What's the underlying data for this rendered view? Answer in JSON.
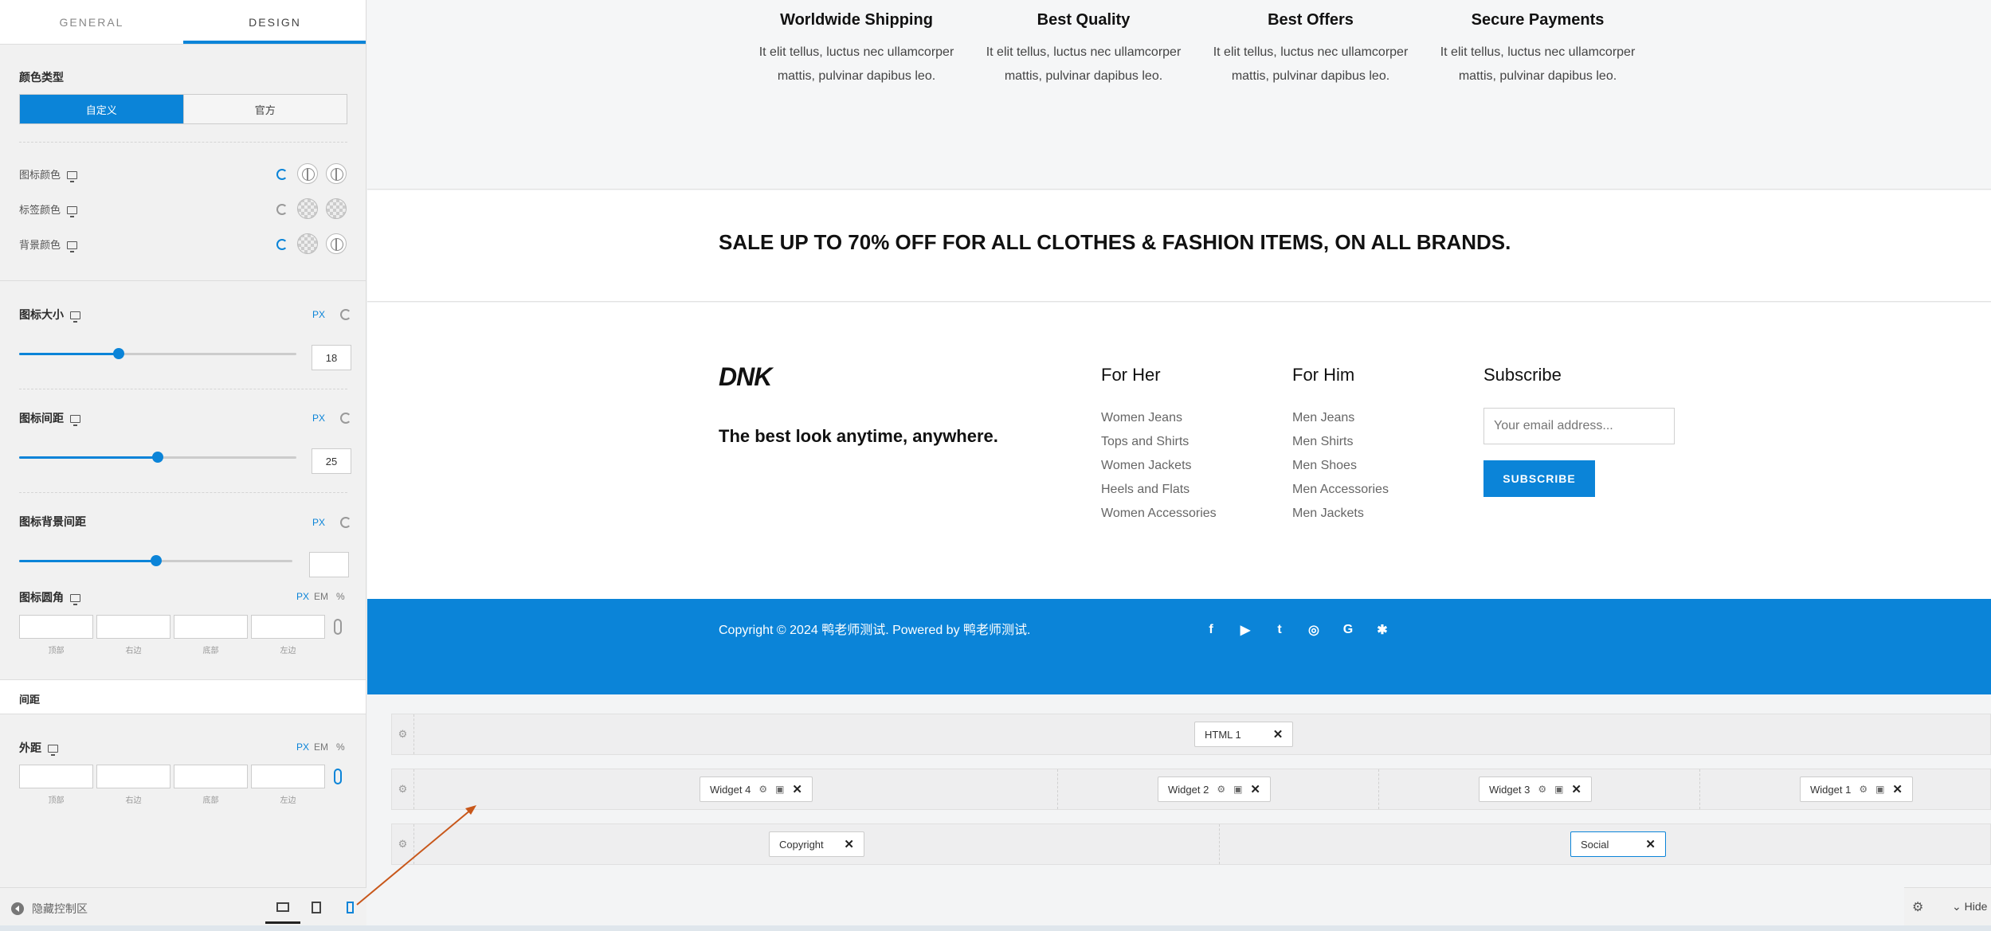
{
  "panel": {
    "tabs": [
      "GENERAL",
      "DESIGN"
    ],
    "color_type_label": "颜色类型",
    "color_type_options": [
      "自定义",
      "官方"
    ],
    "colors": [
      {
        "label": "图标颜色"
      },
      {
        "label": "标签颜色"
      },
      {
        "label": "背景颜色"
      }
    ],
    "icon_size": {
      "label": "图标大小",
      "unit": "PX",
      "value": "18",
      "fraction": 0.36
    },
    "icon_spacing": {
      "label": "图标间距",
      "unit": "PX",
      "value": "25",
      "fraction": 0.5
    },
    "icon_bg_spacing": {
      "label": "图标背景间距",
      "unit": "PX",
      "value": "",
      "fraction": 0.5
    },
    "icon_radius": {
      "label": "图标圆角",
      "units": [
        "PX",
        "EM",
        "%"
      ]
    },
    "side_caps": [
      "顶部",
      "右边",
      "底部",
      "左边"
    ],
    "spacing_section": "间距",
    "margin": {
      "label": "外距",
      "units": [
        "PX",
        "EM",
        "%"
      ]
    },
    "hide_controls": "隐藏控制区"
  },
  "features": [
    {
      "title": "Worldwide Shipping",
      "text": "It elit tellus, luctus nec ullamcorper mattis, pulvinar dapibus leo."
    },
    {
      "title": "Best Quality",
      "text": "It elit tellus, luctus nec ullamcorper mattis, pulvinar dapibus leo."
    },
    {
      "title": "Best Offers",
      "text": "It elit tellus, luctus nec ullamcorper mattis, pulvinar dapibus leo."
    },
    {
      "title": "Secure Payments",
      "text": "It elit tellus, luctus nec ullamcorper mattis, pulvinar dapibus leo."
    }
  ],
  "sale_text": "SALE UP TO 70% OFF FOR ALL CLOTHES & FASHION ITEMS, ON ALL BRANDS.",
  "footer": {
    "logo": "DNK",
    "tagline": "The best look anytime, anywhere.",
    "for_her": {
      "title": "For Her",
      "links": [
        "Women Jeans",
        "Tops and Shirts",
        "Women Jackets",
        "Heels and Flats",
        "Women Accessories"
      ]
    },
    "for_him": {
      "title": "For Him",
      "links": [
        "Men Jeans",
        "Men Shirts",
        "Men Shoes",
        "Men Accessories",
        "Men Jackets"
      ]
    },
    "subscribe": {
      "title": "Subscribe",
      "placeholder": "Your email address...",
      "button": "SUBSCRIBE"
    },
    "copyright": "Copyright © 2024 鸭老师测试. Powered by 鸭老师测试.",
    "social_icons": [
      "facebook-icon",
      "youtube-icon",
      "twitter-icon",
      "instagram-icon",
      "google-icon",
      "yelp-icon"
    ]
  },
  "builder": {
    "row1": [
      "HTML 1"
    ],
    "row2": [
      "Widget 4",
      "Widget 2",
      "Widget 3",
      "Widget 1"
    ],
    "row3": [
      "Copyright",
      "Social"
    ],
    "hide": "Hide"
  },
  "colors": {
    "accent": "#0b84d8"
  }
}
